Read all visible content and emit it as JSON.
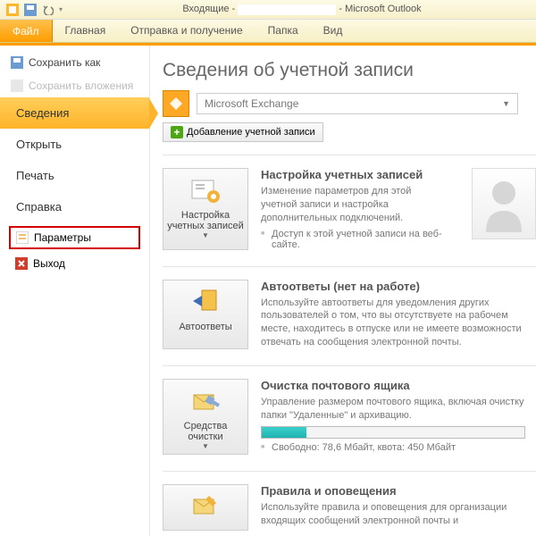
{
  "titlebar": {
    "prefix": "Входящие -",
    "suffix": "- Microsoft Outlook"
  },
  "ribbon": {
    "file": "Файл",
    "tabs": [
      "Главная",
      "Отправка и получение",
      "Папка",
      "Вид"
    ]
  },
  "sidebar": {
    "save_as": "Сохранить как",
    "save_attachments": "Сохранить вложения",
    "info": "Сведения",
    "open": "Открыть",
    "print": "Печать",
    "help": "Справка",
    "options": "Параметры",
    "exit": "Выход"
  },
  "page": {
    "title": "Сведения об учетной записи",
    "account_name": "Microsoft Exchange",
    "add_account": "Добавление учетной записи"
  },
  "sections": {
    "accounts": {
      "btn": "Настройка учетных записей",
      "title": "Настройка учетных записей",
      "desc": "Изменение параметров для этой учетной записи и настройка дополнительных подключений.",
      "bullet": "Доступ к этой учетной записи на веб-сайте."
    },
    "auto": {
      "btn": "Автоответы",
      "title": "Автоответы (нет на работе)",
      "desc": "Используйте автоответы для уведомления других пользователей о том, что вы отсутствуете на рабочем месте, находитесь в отпуске или не имеете возможности отвечать на сообщения электронной почты."
    },
    "cleanup": {
      "btn": "Средства очистки",
      "title": "Очистка почтового ящика",
      "desc": "Управление размером почтового ящика, включая очистку папки \"Удаленные\" и архивацию.",
      "quota": "Свободно: 78,6 Мбайт, квота: 450 Мбайт"
    },
    "rules": {
      "title": "Правила и оповещения",
      "desc": "Используйте правила и оповещения для организации входящих сообщений электронной почты и"
    }
  }
}
